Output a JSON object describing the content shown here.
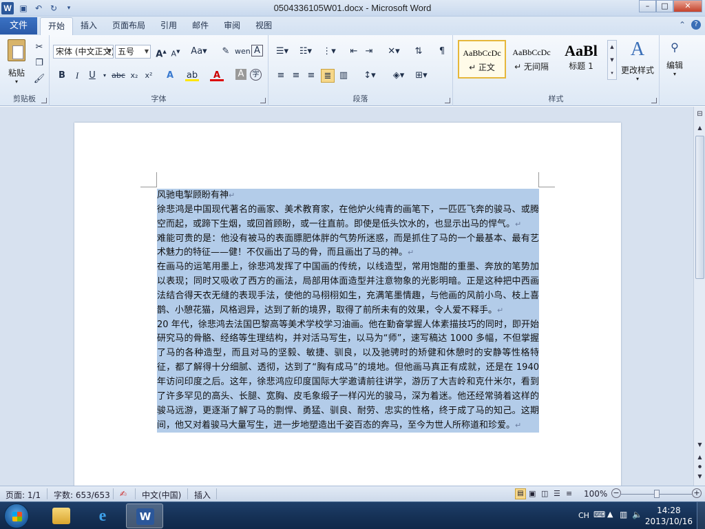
{
  "window": {
    "title": "0504336105W01.docx - Microsoft Word",
    "app_icon_text": "W"
  },
  "qat": {
    "save_icon": "save-icon",
    "undo_icon": "undo-icon",
    "redo_icon": "redo-icon"
  },
  "window_controls": {
    "minimize": "–",
    "maximize": "□",
    "close": "✕"
  },
  "tabs": {
    "file": "文件",
    "items": [
      "开始",
      "插入",
      "页面布局",
      "引用",
      "邮件",
      "审阅",
      "视图"
    ],
    "active": "开始"
  },
  "ribbon": {
    "clipboard": {
      "label": "剪贴板",
      "paste": "粘贴"
    },
    "font": {
      "label": "字体",
      "font_name": "宋体 (中文正文)",
      "font_size": "五号"
    },
    "paragraph": {
      "label": "段落"
    },
    "styles": {
      "label": "样式",
      "tiles": [
        {
          "sample": "AaBbCcDc",
          "name": "↵ 正文"
        },
        {
          "sample": "AaBbCcDc",
          "name": "↵ 无间隔"
        },
        {
          "sample": "AaBl",
          "name": "标题 1"
        }
      ],
      "change_styles": "更改样式"
    },
    "editing": {
      "label": "编辑"
    }
  },
  "document": {
    "paragraphs": [
      "风驰电掣顾盼有神",
      "徐悲鸿是中国现代著名的画家、美术教育家，在他炉火纯青的画笔下，一匹匹飞奔的骏马、或腾空而起，或蹄下生烟，或回首顾盼，或一往直前。即使是低头饮水的，也显示出马的悍气。",
      "难能可贵的是：他没有被马的表面膘肥体胖的气势所迷惑，而是抓住了马的一个最基本、最有艺术魅力的特征——健！不仅画出了马的骨，而且画出了马的神。",
      "在画马的运笔用墨上，徐悲鸿发挥了中国画的传统，以线造型，常用饱酣的重墨、奔放的笔势加以表现；同时又吸收了西方的画法，局部用体面造型并注意物象的光影明暗。正是这种把中西画法结合得天衣无缝的表现手法，使他的马栩栩如生，充满笔墨情趣，与他画的风前小鸟、枝上喜鹊、小憩花猫，风格迥异，达到了新的境界，取得了前所未有的效果，令人爱不释手。",
      "20 年代，徐悲鸿去法国巴黎高等美术学校学习油画。他在勤奋掌握人体素描技巧的同时，即开始研究马的骨骼、经络等生理结构，并对活马写生，以马为“师”，速写稿达 1000 多幅，不但掌握了马的各种造型，而且对马的坚毅、敏捷、驯良，以及驰骋时的矫健和休憩时的安静等性格特征，都了解得十分细腻、透彻，达到了“胸有成马”的境地。但他画马真正有成就，还是在 1940 年访问印度之后。这年，徐悲鸿应印度国际大学邀请前往讲学，游历了大吉岭和克什米尔，看到了许多罕见的高头、长腿、宽胸、皮毛象缎子一样闪光的骏马，深为着迷。他还经常骑着这样的骏马远游，更逐渐了解了马的剽悍、勇猛、驯良、耐劳、忠实的性格，终于成了马的知己。这期间，他又对着骏马大量写生，进一步地塑造出千姿百态的奔马，至今为世人所称道和珍爱。"
    ],
    "paragraph_mark": "↵"
  },
  "statusbar": {
    "page": "页面: 1/1",
    "words": "字数: 653/653",
    "language": "中文(中国)",
    "mode": "插入",
    "zoom": "100%",
    "zoom_level": 1.0
  },
  "taskbar": {
    "ime": "CH",
    "time": "14:28",
    "date": "2013/10/16"
  },
  "colors": {
    "selection": "#b3cce9",
    "file_tab": "#2b579a",
    "ribbon_bg": "#dde8f5"
  }
}
